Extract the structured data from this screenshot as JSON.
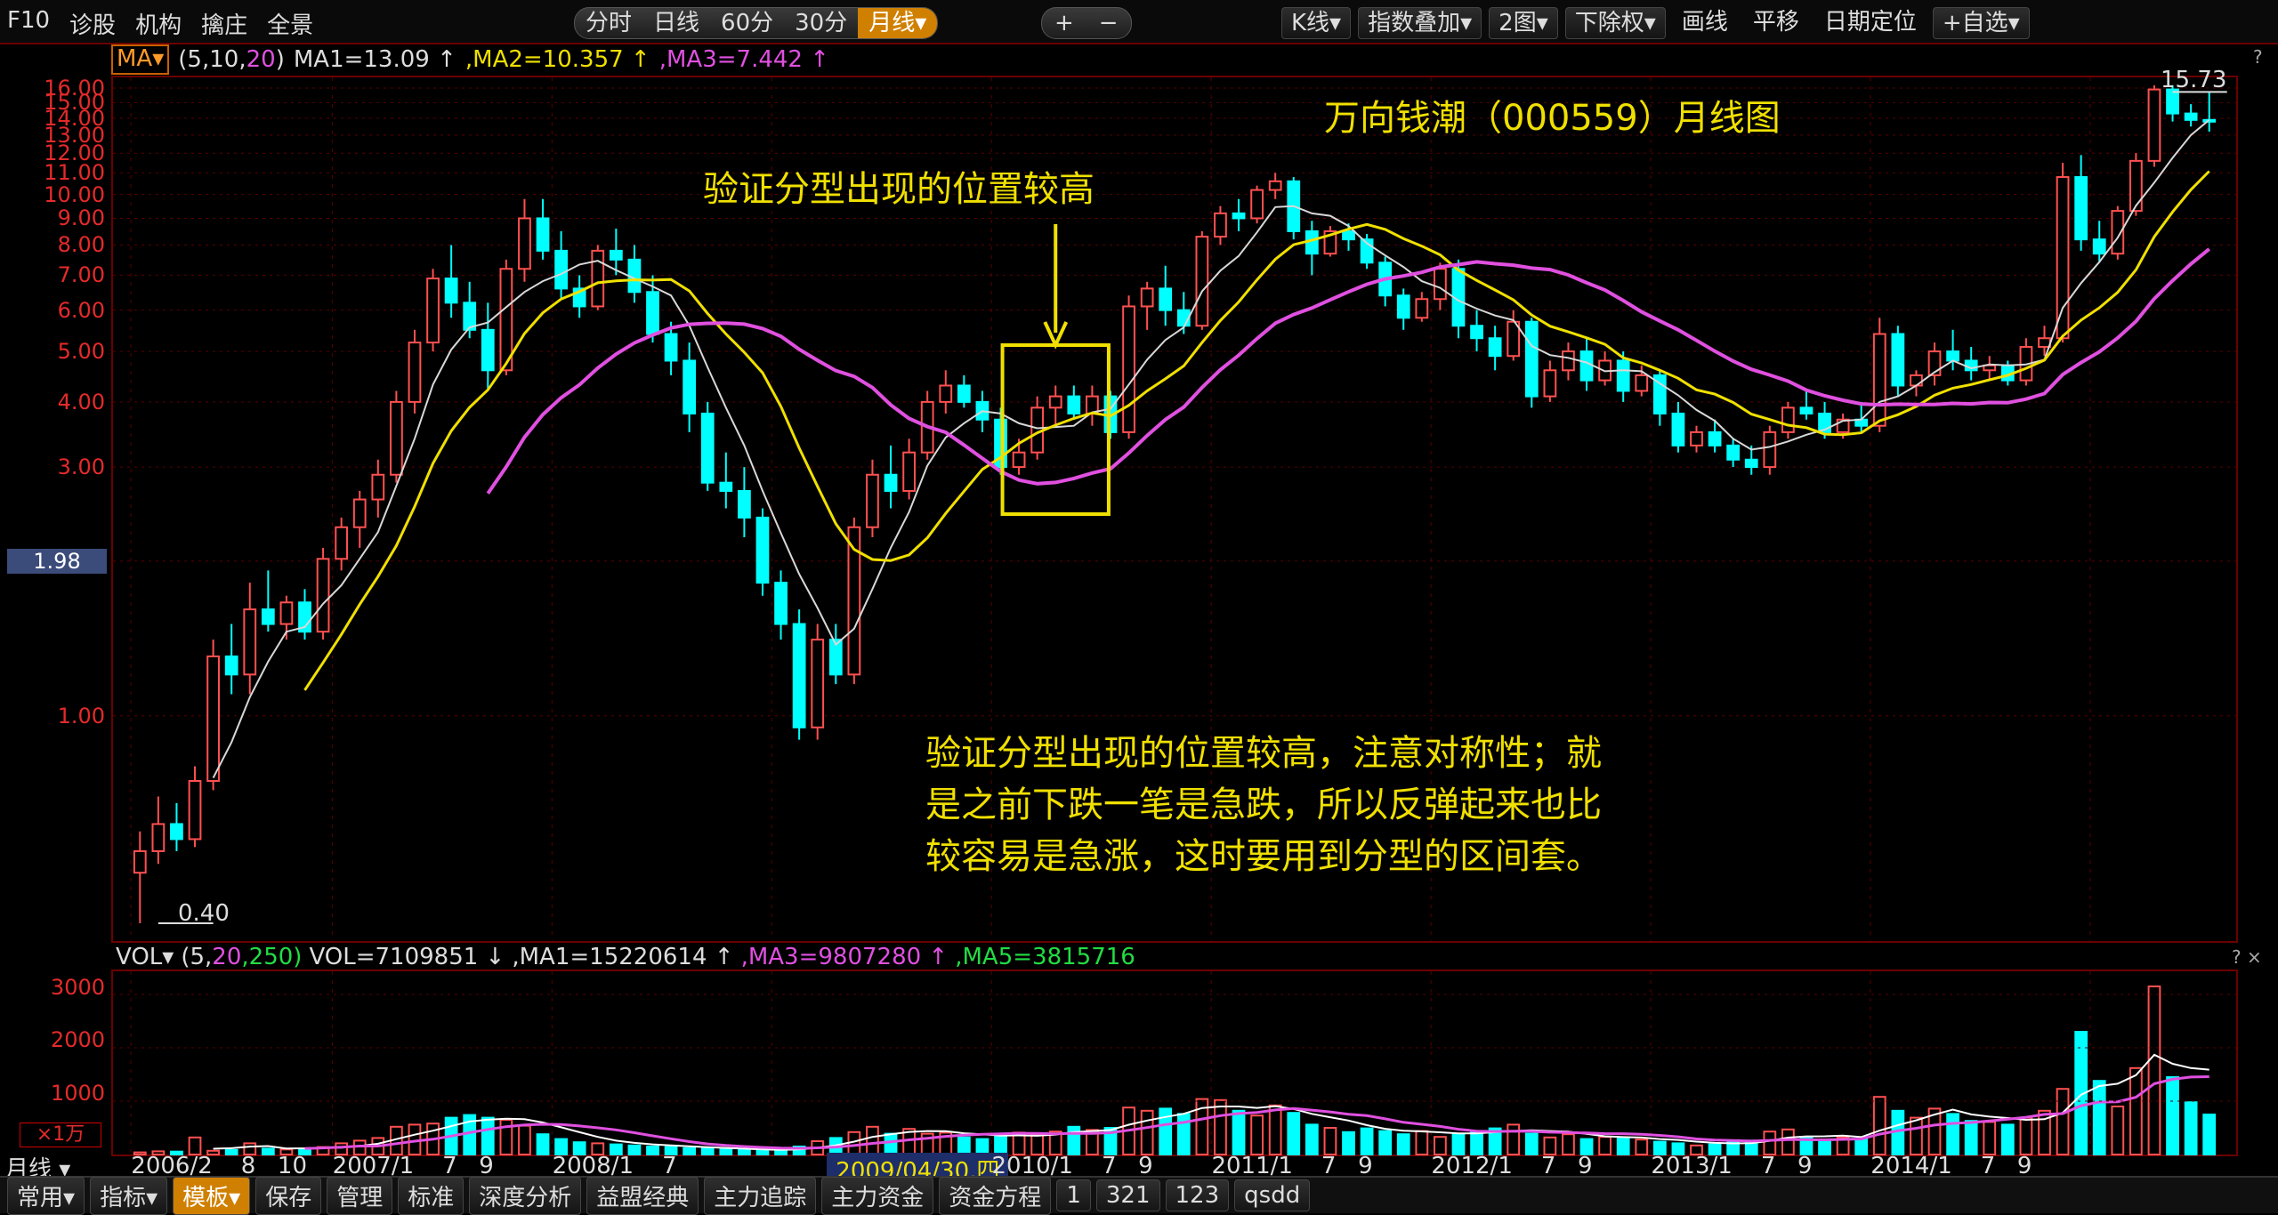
{
  "toolbar": {
    "left_items": [
      "F10",
      "诊股",
      "机构",
      "擒庄",
      "全景"
    ],
    "periods": [
      "分时",
      "日线",
      "60分",
      "30分",
      "月线▾"
    ],
    "active_period": "月线▾",
    "zoom": [
      "+",
      "−"
    ],
    "right_items": [
      "K线▾",
      "指数叠加▾",
      "2图▾",
      "下除权▾",
      "画线",
      "平移",
      "日期定位",
      "+自选▾"
    ]
  },
  "ma_info": {
    "badge": "MA▾",
    "params_prefix": "(5,10,",
    "params_20": "20",
    "params_suffix": ")",
    "ma1": "MA1=13.09 ↑",
    "ma2": ",MA2=10.357 ↑",
    "ma3": ",MA3=7.442 ↑"
  },
  "price_axis": {
    "labels": [
      "16.00",
      "15.00",
      "14.00",
      "13.00",
      "12.00",
      "11.00",
      "10.00",
      "9.00",
      "8.00",
      "7.00",
      "6.00",
      "5.00",
      "4.00",
      "3.00",
      "1.98",
      "1.00"
    ],
    "current_price_tag": "1.98",
    "high_label": "15.73",
    "low_label": "0.40"
  },
  "annotations": {
    "chart_title": "万向钱潮（000559）月线图",
    "arrow_note": "验证分型出现的位置较高",
    "body_line1": "验证分型出现的位置较高，注意对称性；就",
    "body_line2": "是之前下跌一笔是急跌，所以反弹起来也比",
    "body_line3": "较容易是急涨，这时要用到分型的区间套。"
  },
  "vol_info": {
    "label": "VOL▾",
    "params_prefix": "(5,",
    "params_20": "20",
    "params_250": ",250)",
    "vol": "VOL=7109851 ↓",
    "ma1": ",MA1=15220614 ↑",
    "ma3": ",MA3=9807280 ↑",
    "ma5": ",MA5=3815716"
  },
  "vol_axis": {
    "labels": [
      "3000",
      "2000",
      "1000"
    ],
    "unit": "×1万"
  },
  "x_axis": {
    "period_label": "月线 ▾",
    "ticks": [
      "2006/2",
      "8",
      "10",
      "2007/1",
      "7",
      "9",
      "2008/1",
      "7",
      "2009/04/30,四",
      "2010/1",
      "7",
      "9",
      "2011/1",
      "7",
      "9",
      "2012/1",
      "7",
      "9",
      "2013/1",
      "7",
      "9",
      "2014/1",
      "7",
      "9"
    ]
  },
  "bottombar": {
    "items": [
      "常用▾",
      "指标▾",
      "模板▾",
      "保存",
      "管理",
      "标准",
      "深度分析",
      "益盟经典",
      "主力追踪",
      "主力资金",
      "资金方程",
      "1",
      "321",
      "123",
      "qsdd"
    ],
    "active_item": "模板▾"
  },
  "panel_controls": [
    "?",
    "×"
  ],
  "colors": {
    "up": "#ff5050",
    "down": "#00ffff",
    "ma1": "#d8d8d8",
    "ma2": "#f0e000",
    "ma3": "#e050e0",
    "vol_ma5": "#22dd44",
    "annotation": "#f0e000",
    "grid": "#6b0000"
  },
  "chart_data": {
    "type": "candlestick",
    "scale": "log",
    "price_range": [
      0.4,
      15.73
    ],
    "candles": [
      [
        0.5,
        0.6,
        0.4,
        0.55
      ],
      [
        0.55,
        0.7,
        0.52,
        0.62
      ],
      [
        0.62,
        0.68,
        0.55,
        0.58
      ],
      [
        0.58,
        0.8,
        0.56,
        0.75
      ],
      [
        0.75,
        1.4,
        0.72,
        1.3
      ],
      [
        1.3,
        1.5,
        1.1,
        1.2
      ],
      [
        1.2,
        1.8,
        1.1,
        1.6
      ],
      [
        1.6,
        1.9,
        1.45,
        1.5
      ],
      [
        1.5,
        1.7,
        1.4,
        1.65
      ],
      [
        1.65,
        1.75,
        1.4,
        1.45
      ],
      [
        1.45,
        2.1,
        1.4,
        2.0
      ],
      [
        2.0,
        2.4,
        1.9,
        2.3
      ],
      [
        2.3,
        2.7,
        2.1,
        2.6
      ],
      [
        2.6,
        3.1,
        2.4,
        2.9
      ],
      [
        2.9,
        4.2,
        2.8,
        4.0
      ],
      [
        4.0,
        5.5,
        3.8,
        5.2
      ],
      [
        5.2,
        7.2,
        5.0,
        6.9
      ],
      [
        6.9,
        8.0,
        5.8,
        6.2
      ],
      [
        6.2,
        6.8,
        5.3,
        5.5
      ],
      [
        5.5,
        6.2,
        4.2,
        4.6
      ],
      [
        4.6,
        7.5,
        4.5,
        7.2
      ],
      [
        7.2,
        9.8,
        6.8,
        9.0
      ],
      [
        9.0,
        9.8,
        7.5,
        7.8
      ],
      [
        7.8,
        8.5,
        6.3,
        6.6
      ],
      [
        6.6,
        7.0,
        5.8,
        6.1
      ],
      [
        6.1,
        8.0,
        6.0,
        7.8
      ],
      [
        7.8,
        8.6,
        7.0,
        7.5
      ],
      [
        7.5,
        8.0,
        6.2,
        6.5
      ],
      [
        6.5,
        7.0,
        5.2,
        5.4
      ],
      [
        5.4,
        5.7,
        4.5,
        4.8
      ],
      [
        4.8,
        5.2,
        3.5,
        3.8
      ],
      [
        3.8,
        4.0,
        2.7,
        2.8
      ],
      [
        2.8,
        3.2,
        2.5,
        2.7
      ],
      [
        2.7,
        3.0,
        2.2,
        2.4
      ],
      [
        2.4,
        2.5,
        1.7,
        1.8
      ],
      [
        1.8,
        1.9,
        1.4,
        1.5
      ],
      [
        1.5,
        1.6,
        0.9,
        0.95
      ],
      [
        0.95,
        1.5,
        0.9,
        1.4
      ],
      [
        1.4,
        1.5,
        1.15,
        1.2
      ],
      [
        1.2,
        2.4,
        1.15,
        2.3
      ],
      [
        2.3,
        3.1,
        2.2,
        2.9
      ],
      [
        2.9,
        3.3,
        2.5,
        2.7
      ],
      [
        2.7,
        3.4,
        2.6,
        3.2
      ],
      [
        3.2,
        4.2,
        3.1,
        4.0
      ],
      [
        4.0,
        4.6,
        3.8,
        4.3
      ],
      [
        4.3,
        4.5,
        3.9,
        4.0
      ],
      [
        4.0,
        4.2,
        3.5,
        3.7
      ],
      [
        3.7,
        3.9,
        2.9,
        3.0
      ],
      [
        3.0,
        3.4,
        2.9,
        3.2
      ],
      [
        3.2,
        4.1,
        3.1,
        3.9
      ],
      [
        3.9,
        4.3,
        3.6,
        4.1
      ],
      [
        4.1,
        4.3,
        3.7,
        3.8
      ],
      [
        3.8,
        4.3,
        3.6,
        4.1
      ],
      [
        4.1,
        4.2,
        3.4,
        3.5
      ],
      [
        3.5,
        6.4,
        3.4,
        6.1
      ],
      [
        6.1,
        6.8,
        5.5,
        6.6
      ],
      [
        6.6,
        7.3,
        5.6,
        6.0
      ],
      [
        6.0,
        6.5,
        5.4,
        5.6
      ],
      [
        5.6,
        8.5,
        5.5,
        8.3
      ],
      [
        8.3,
        9.5,
        8.0,
        9.2
      ],
      [
        9.2,
        9.8,
        8.5,
        9.0
      ],
      [
        9.0,
        10.4,
        8.8,
        10.2
      ],
      [
        10.2,
        11.0,
        9.8,
        10.6
      ],
      [
        10.6,
        10.8,
        8.2,
        8.5
      ],
      [
        8.5,
        8.9,
        7.0,
        7.7
      ],
      [
        7.7,
        8.7,
        7.6,
        8.5
      ],
      [
        8.5,
        8.8,
        7.8,
        8.2
      ],
      [
        8.2,
        8.4,
        7.2,
        7.4
      ],
      [
        7.4,
        7.6,
        6.1,
        6.4
      ],
      [
        6.4,
        6.6,
        5.5,
        5.8
      ],
      [
        5.8,
        6.5,
        5.7,
        6.3
      ],
      [
        6.3,
        7.4,
        6.0,
        7.2
      ],
      [
        7.2,
        7.5,
        5.3,
        5.6
      ],
      [
        5.6,
        6.0,
        5.0,
        5.3
      ],
      [
        5.3,
        5.6,
        4.6,
        4.9
      ],
      [
        4.9,
        6.0,
        4.8,
        5.7
      ],
      [
        5.7,
        5.8,
        3.9,
        4.1
      ],
      [
        4.1,
        4.8,
        4.0,
        4.6
      ],
      [
        4.6,
        5.2,
        4.4,
        5.0
      ],
      [
        5.0,
        5.3,
        4.2,
        4.4
      ],
      [
        4.4,
        5.0,
        4.3,
        4.8
      ],
      [
        4.8,
        5.0,
        4.0,
        4.2
      ],
      [
        4.2,
        4.7,
        4.1,
        4.5
      ],
      [
        4.5,
        4.6,
        3.6,
        3.8
      ],
      [
        3.8,
        4.0,
        3.2,
        3.3
      ],
      [
        3.3,
        3.6,
        3.2,
        3.5
      ],
      [
        3.5,
        3.7,
        3.2,
        3.3
      ],
      [
        3.3,
        3.4,
        3.0,
        3.1
      ],
      [
        3.1,
        3.3,
        2.9,
        3.0
      ],
      [
        3.0,
        3.6,
        2.9,
        3.5
      ],
      [
        3.5,
        4.0,
        3.4,
        3.9
      ],
      [
        3.9,
        4.2,
        3.7,
        3.8
      ],
      [
        3.8,
        4.0,
        3.4,
        3.5
      ],
      [
        3.5,
        3.8,
        3.4,
        3.7
      ],
      [
        3.7,
        4.0,
        3.5,
        3.6
      ],
      [
        3.6,
        5.8,
        3.5,
        5.4
      ],
      [
        5.4,
        5.6,
        4.1,
        4.3
      ],
      [
        4.3,
        4.6,
        4.1,
        4.5
      ],
      [
        4.5,
        5.2,
        4.3,
        5.0
      ],
      [
        5.0,
        5.5,
        4.6,
        4.8
      ],
      [
        4.8,
        5.1,
        4.4,
        4.6
      ],
      [
        4.6,
        4.9,
        4.4,
        4.7
      ],
      [
        4.7,
        4.8,
        4.3,
        4.4
      ],
      [
        4.4,
        5.3,
        4.3,
        5.1
      ],
      [
        5.1,
        5.6,
        4.9,
        5.3
      ],
      [
        5.3,
        11.5,
        5.2,
        10.8
      ],
      [
        10.8,
        11.9,
        7.8,
        8.2
      ],
      [
        8.2,
        8.9,
        7.4,
        7.7
      ],
      [
        7.7,
        9.5,
        7.5,
        9.3
      ],
      [
        9.3,
        12.0,
        9.1,
        11.6
      ],
      [
        11.6,
        16.2,
        11.3,
        15.9
      ],
      [
        15.9,
        16.2,
        13.8,
        14.3
      ],
      [
        14.3,
        14.9,
        13.5,
        13.9
      ],
      [
        13.9,
        15.73,
        13.2,
        13.8
      ]
    ],
    "volume": [
      40,
      60,
      55,
      320,
      70,
      85,
      210,
      110,
      95,
      85,
      140,
      210,
      260,
      310,
      520,
      560,
      580,
      690,
      740,
      690,
      650,
      540,
      380,
      290,
      230,
      210,
      190,
      170,
      150,
      140,
      120,
      110,
      95,
      85,
      70,
      75,
      150,
      250,
      310,
      420,
      520,
      390,
      480,
      390,
      410,
      320,
      290,
      360,
      410,
      380,
      430,
      520,
      460,
      500,
      880,
      820,
      860,
      760,
      1040,
      1020,
      820,
      730,
      920,
      780,
      560,
      500,
      420,
      490,
      440,
      380,
      440,
      330,
      390,
      440,
      490,
      560,
      390,
      320,
      380,
      290,
      330,
      310,
      280,
      240,
      210,
      170,
      190,
      230,
      260,
      430,
      470,
      310,
      240,
      320,
      290,
      1080,
      820,
      690,
      860,
      760,
      630,
      610,
      560,
      690,
      820,
      1230,
      2300,
      1380,
      900,
      1620,
      3150,
      1450,
      980,
      750
    ],
    "vol_range": [
      0,
      3300
    ]
  }
}
